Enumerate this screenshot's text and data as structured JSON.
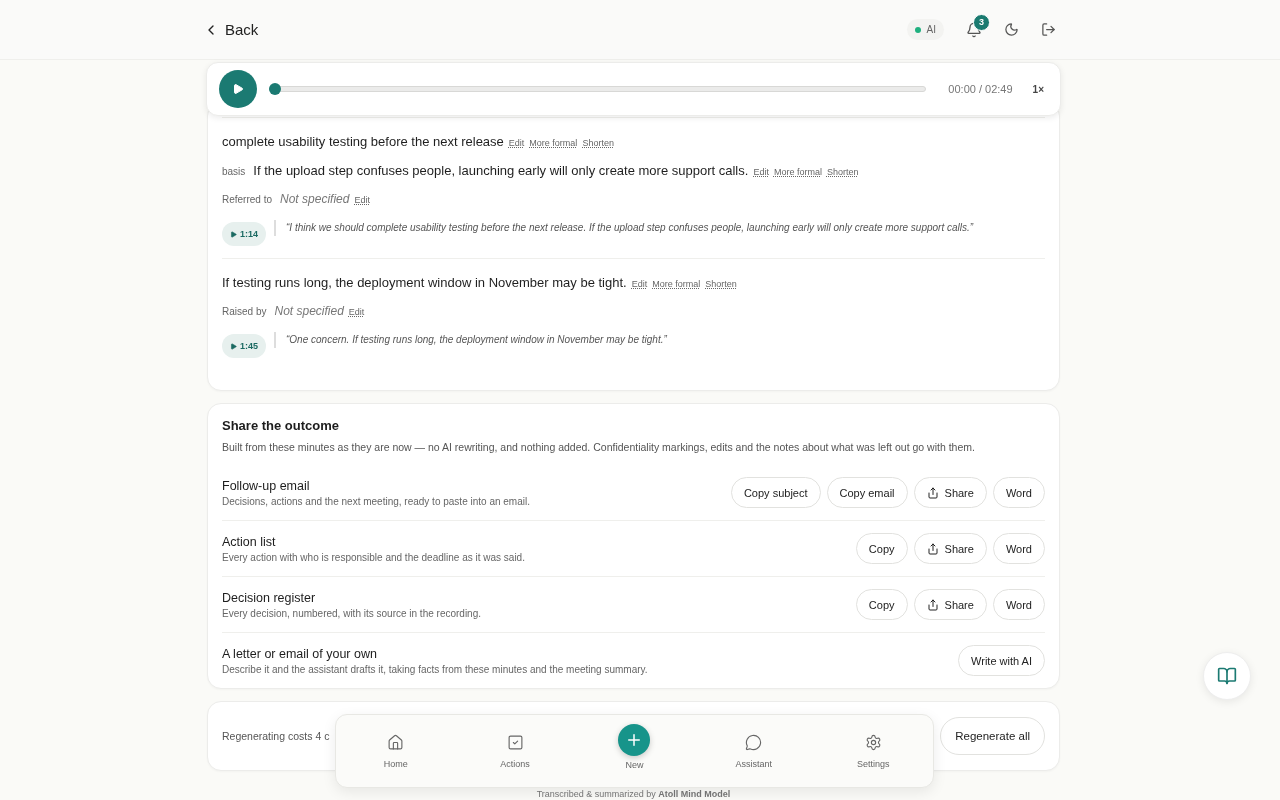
{
  "header": {
    "back": "Back",
    "ai_badge": "AI",
    "ai_on": true,
    "notifications": "3"
  },
  "player": {
    "time": "00:00 / 02:49",
    "speed": "1×",
    "level": 0
  },
  "points": [
    {
      "text": "complete usability testing before the next release",
      "actions": [
        "Edit",
        "More formal",
        "Shorten"
      ],
      "basis_label": "basis",
      "basis": "If the upload step confuses people, launching early will only create more support calls.",
      "basis_actions": [
        "Edit",
        "More formal",
        "Shorten"
      ],
      "person_label": "Referred to",
      "person": "Not specified",
      "person_edit": "Edit",
      "timestamp": "1:14",
      "quote": "“I think we should complete usability testing before the next release. If the upload step confuses people, launching early will only create more support calls.”"
    },
    {
      "text": "If testing runs long, the deployment window in November may be tight.",
      "actions": [
        "Edit",
        "More formal",
        "Shorten"
      ],
      "person_label": "Raised by",
      "person": "Not specified",
      "person_edit": "Edit",
      "timestamp": "1:45",
      "quote": "“One concern. If testing runs long, the deployment window in November may be tight.”"
    }
  ],
  "share": {
    "title": "Share the outcome",
    "description": "Built from these minutes as they are now — no AI rewriting, and nothing added. Confidentiality markings, edits and the notes about what was left out go with them.",
    "rows": [
      {
        "title": "Follow-up email",
        "description": "Decisions, actions and the next meeting, ready to paste into an email.",
        "buttons": [
          {
            "label": "Copy subject",
            "kind": "plain"
          },
          {
            "label": "Copy email",
            "kind": "plain"
          },
          {
            "label": "Share",
            "kind": "share"
          },
          {
            "label": "Word",
            "kind": "plain"
          }
        ]
      },
      {
        "title": "Action list",
        "description": "Every action with who is responsible and the deadline as it was said.",
        "buttons": [
          {
            "label": "Copy",
            "kind": "plain"
          },
          {
            "label": "Share",
            "kind": "share"
          },
          {
            "label": "Word",
            "kind": "plain"
          }
        ]
      },
      {
        "title": "Decision register",
        "description": "Every decision, numbered, with its source in the recording.",
        "buttons": [
          {
            "label": "Copy",
            "kind": "plain"
          },
          {
            "label": "Share",
            "kind": "share"
          },
          {
            "label": "Word",
            "kind": "plain"
          }
        ]
      },
      {
        "title": "A letter or email of your own",
        "description": "Describe it and the assistant drafts it, taking facts from these minutes and the meeting summary.",
        "buttons": [
          {
            "label": "Write with AI",
            "kind": "plain"
          }
        ]
      }
    ]
  },
  "regenerate": {
    "text": "Regenerating costs 4 c",
    "button": "Regenerate all"
  },
  "nav": [
    {
      "label": "Home",
      "kind": "home"
    },
    {
      "label": "Actions",
      "kind": "actions"
    },
    {
      "label": "New",
      "kind": "new"
    },
    {
      "label": "Assistant",
      "kind": "assistant"
    },
    {
      "label": "Settings",
      "kind": "settings"
    }
  ],
  "footer": "Transcribed & summarized by **Atoll Mind Model**"
}
